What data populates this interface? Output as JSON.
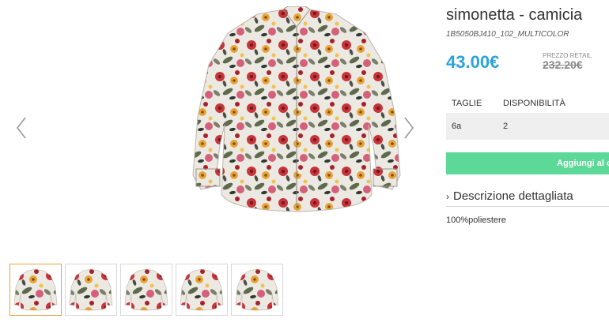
{
  "product": {
    "title": "simonetta - camicia",
    "sku": "1B5050BJ410_102_MULTICOLOR",
    "price": "43.00€",
    "retail_label": "PREZZO RETAIL",
    "retail_price": "232.20€",
    "accent_color": "#2aa3dc",
    "cart_color": "#5cd998"
  },
  "stock": {
    "headers": {
      "size": "TAGLIE",
      "availability": "DISPONIBILITÀ"
    },
    "rows": [
      {
        "size": "6a",
        "availability": "2"
      }
    ]
  },
  "actions": {
    "add_to_cart": "Aggiungi al ca"
  },
  "description": {
    "toggle_label": "Descrizione dettagliata",
    "text": "100%poliestere"
  },
  "gallery": {
    "prev_icon": "chevron-left-icon",
    "next_icon": "chevron-right-icon",
    "thumbnail_count": 5,
    "active_thumbnail": 1
  }
}
